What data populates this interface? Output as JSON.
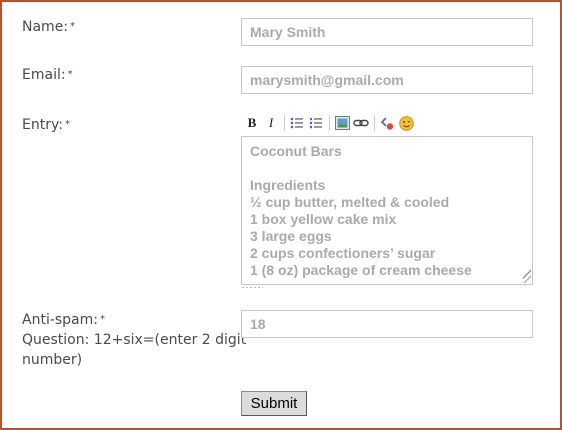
{
  "form": {
    "name": {
      "label": "Name:",
      "required_marker": "*",
      "value": "Mary Smith"
    },
    "email": {
      "label": "Email:",
      "required_marker": "*",
      "value": "marysmith@gmail.com"
    },
    "entry": {
      "label": "Entry:",
      "required_marker": "*",
      "toolbar": [
        "bold",
        "italic",
        "bulleted-list",
        "numbered-list",
        "insert-image",
        "insert-link",
        "insert-code",
        "insert-emoji"
      ],
      "toolbar_labels": {
        "bold": "B",
        "italic": "I"
      },
      "lines": [
        "Coconut Bars",
        "",
        "Ingredients",
        "½ cup butter, melted & cooled",
        "1 box yellow cake mix",
        "3 large eggs",
        "2 cups confectioners’ sugar",
        "1 (8 oz) package of cream cheese"
      ]
    },
    "antispam": {
      "label": "Anti-spam:",
      "required_marker": "*",
      "question_line1": "Question: 12+six=(enter 2 digit",
      "question_line2": "number)",
      "value": "18"
    },
    "submit_label": "Submit"
  },
  "colors": {
    "frame_border": "#b8502a",
    "label_text": "#4a4a4a",
    "input_text": "#aaaaaa"
  }
}
